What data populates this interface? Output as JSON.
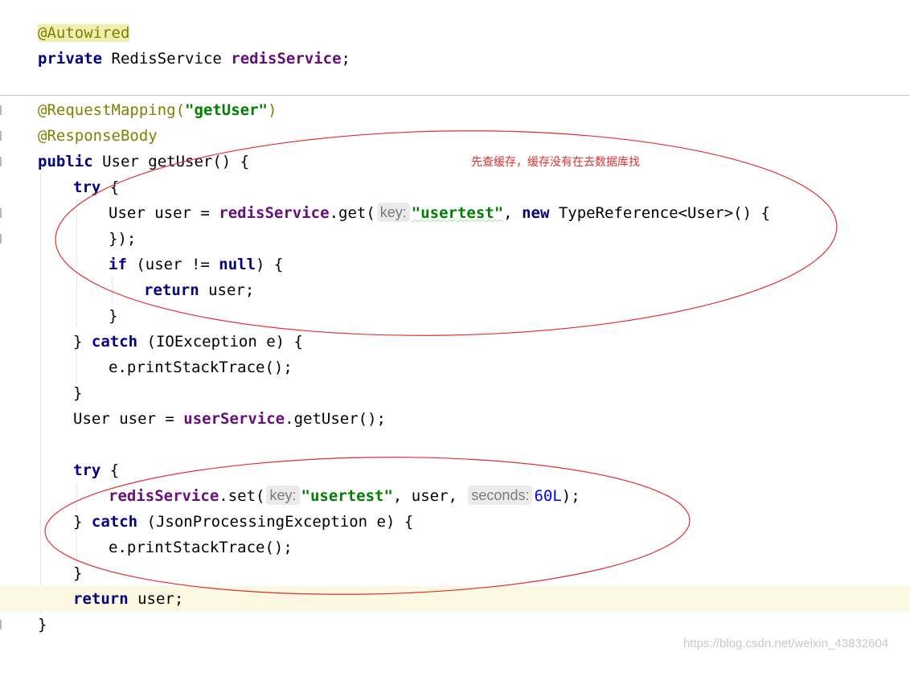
{
  "code": {
    "autowired_annotation": "@Autowired",
    "kw_private": "private",
    "type_redis_service": "RedisService",
    "field_redis_service": "redisService",
    "semicolon": ";",
    "request_mapping_annotation": "@RequestMapping(",
    "request_mapping_value": "\"getUser\"",
    "close_paren": ")",
    "response_body_annotation": "@ResponseBody",
    "kw_public": "public",
    "method_signature": "User getUser() {",
    "kw_try": "try",
    "open_brace": " {",
    "user_decl_prefix": "User user = ",
    "method_get": ".get(",
    "hint_key": "key:",
    "key_value": "\"usertest\"",
    "comma_space": ", ",
    "kw_new": "new",
    "type_reference": " TypeReference<User>() {",
    "close_anon": "});",
    "kw_if": "if",
    "if_condition_open": " (user != ",
    "kw_null": "null",
    "if_condition_close": ") {",
    "kw_return": "return",
    "return_value": " user;",
    "close_brace": "}",
    "close_brace_prefix": "} ",
    "kw_catch": "catch",
    "catch_io": " (IOException e) {",
    "print_stack_trace": "e.printStackTrace();",
    "user_service_prefix": "User user = ",
    "field_user_service": "userService",
    "user_service_call": ".getUser();",
    "method_set": ".set(",
    "set_user_arg": ", user, ",
    "hint_seconds": "seconds:",
    "seconds_value": "60L",
    "set_close": ");",
    "catch_json": " (JsonProcessingException e) {"
  },
  "annotation_note": "先查缓存，缓存没有在去数据库找",
  "watermark": "https://blog.csdn.net/weixin_43832604",
  "colors": {
    "keyword": "#000080",
    "annotation": "#808000",
    "string": "#008000",
    "field": "#660e7a",
    "number": "#0000ff",
    "circle": "#e03030",
    "current_line": "#fdf8e1"
  }
}
